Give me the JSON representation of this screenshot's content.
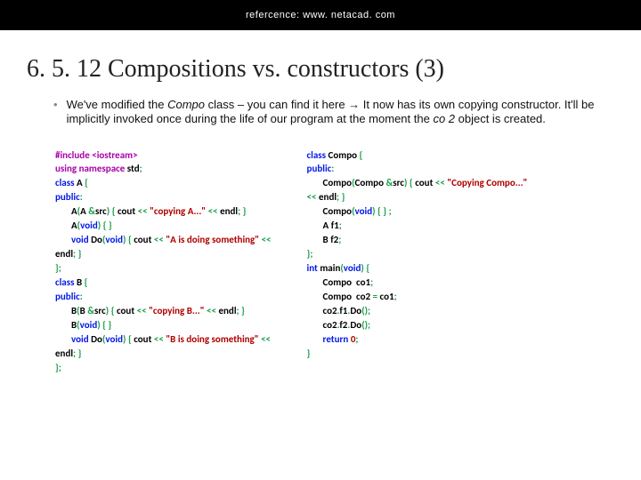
{
  "header": {
    "reference": "refercence: www. netacad. com"
  },
  "title": "6. 5. 12 Compositions vs. constructors (3)",
  "bullet": {
    "pre": "We've modified the ",
    "italic1": "Compo",
    "mid": " class – you can find it here → It now has its own copying constructor. It'll be implicitly invoked once during the life of our program at the moment the ",
    "italic2": "co 2",
    "post": " object is created."
  },
  "code": {
    "left": [
      [
        {
          "c": "pp",
          "t": "#include <iostream>"
        }
      ],
      [
        {
          "c": "pp",
          "t": "using namespace "
        },
        {
          "c": "id",
          "t": "std"
        },
        {
          "c": "pn2",
          "t": ";"
        }
      ],
      [
        {
          "c": "kw",
          "t": "class "
        },
        {
          "c": "id",
          "t": "A "
        },
        {
          "c": "pn2",
          "t": "{"
        }
      ],
      [
        {
          "c": "kw",
          "t": "public"
        },
        {
          "c": "pn2",
          "t": ":"
        }
      ],
      [
        {
          "c": "sp",
          "t": ""
        },
        {
          "c": "id",
          "t": "A"
        },
        {
          "c": "pn2",
          "t": "("
        },
        {
          "c": "id",
          "t": "A "
        },
        {
          "c": "pn2",
          "t": "&"
        },
        {
          "c": "id",
          "t": "src"
        },
        {
          "c": "pn2",
          "t": ") { "
        },
        {
          "c": "id",
          "t": "cout "
        },
        {
          "c": "pn2",
          "t": "<< "
        },
        {
          "c": "str",
          "t": "\"copying A...\""
        },
        {
          "c": "pn2",
          "t": " << "
        },
        {
          "c": "id",
          "t": "endl"
        },
        {
          "c": "pn2",
          "t": "; }"
        }
      ],
      [
        {
          "c": "sp",
          "t": ""
        },
        {
          "c": "id",
          "t": "A"
        },
        {
          "c": "pn2",
          "t": "("
        },
        {
          "c": "kw",
          "t": "void"
        },
        {
          "c": "pn2",
          "t": ") { }"
        }
      ],
      [
        {
          "c": "sp",
          "t": ""
        },
        {
          "c": "kw",
          "t": "void "
        },
        {
          "c": "id",
          "t": "Do"
        },
        {
          "c": "pn2",
          "t": "("
        },
        {
          "c": "kw",
          "t": "void"
        },
        {
          "c": "pn2",
          "t": ") { "
        },
        {
          "c": "id",
          "t": "cout "
        },
        {
          "c": "pn2",
          "t": "<< "
        },
        {
          "c": "str",
          "t": "\"A is doing something\""
        },
        {
          "c": "pn2",
          "t": " <<"
        }
      ],
      [
        {
          "c": "id",
          "t": "endl"
        },
        {
          "c": "pn2",
          "t": "; }"
        }
      ],
      [
        {
          "c": "pn2",
          "t": "};"
        }
      ],
      [
        {
          "c": "kw",
          "t": "class "
        },
        {
          "c": "id",
          "t": "B "
        },
        {
          "c": "pn2",
          "t": "{"
        }
      ],
      [
        {
          "c": "kw",
          "t": "public"
        },
        {
          "c": "pn2",
          "t": ":"
        }
      ],
      [
        {
          "c": "sp",
          "t": ""
        },
        {
          "c": "id",
          "t": "B"
        },
        {
          "c": "pn2",
          "t": "("
        },
        {
          "c": "id",
          "t": "B "
        },
        {
          "c": "pn2",
          "t": "&"
        },
        {
          "c": "id",
          "t": "src"
        },
        {
          "c": "pn2",
          "t": ") { "
        },
        {
          "c": "id",
          "t": "cout "
        },
        {
          "c": "pn2",
          "t": "<< "
        },
        {
          "c": "str",
          "t": "\"copying B...\""
        },
        {
          "c": "pn2",
          "t": " << "
        },
        {
          "c": "id",
          "t": "endl"
        },
        {
          "c": "pn2",
          "t": "; }"
        }
      ],
      [
        {
          "c": "sp",
          "t": ""
        },
        {
          "c": "id",
          "t": "B"
        },
        {
          "c": "pn2",
          "t": "("
        },
        {
          "c": "kw",
          "t": "void"
        },
        {
          "c": "pn2",
          "t": ") { }"
        }
      ],
      [
        {
          "c": "sp",
          "t": ""
        },
        {
          "c": "kw",
          "t": "void "
        },
        {
          "c": "id",
          "t": "Do"
        },
        {
          "c": "pn2",
          "t": "("
        },
        {
          "c": "kw",
          "t": "void"
        },
        {
          "c": "pn2",
          "t": ") { "
        },
        {
          "c": "id",
          "t": "cout "
        },
        {
          "c": "pn2",
          "t": "<< "
        },
        {
          "c": "str",
          "t": "\"B is doing something\""
        },
        {
          "c": "pn2",
          "t": " <<"
        }
      ],
      [
        {
          "c": "id",
          "t": "endl"
        },
        {
          "c": "pn2",
          "t": "; }"
        }
      ],
      [
        {
          "c": "pn2",
          "t": "};"
        }
      ]
    ],
    "right": [
      [
        {
          "c": "kw",
          "t": "class "
        },
        {
          "c": "id",
          "t": "Compo "
        },
        {
          "c": "pn2",
          "t": "{"
        }
      ],
      [
        {
          "c": "kw",
          "t": "public"
        },
        {
          "c": "pn2",
          "t": ":"
        }
      ],
      [
        {
          "c": "sp",
          "t": ""
        },
        {
          "c": "id",
          "t": "Compo"
        },
        {
          "c": "pn2",
          "t": "("
        },
        {
          "c": "id",
          "t": "Compo "
        },
        {
          "c": "pn2",
          "t": "&"
        },
        {
          "c": "id",
          "t": "src"
        },
        {
          "c": "pn2",
          "t": ") { "
        },
        {
          "c": "id",
          "t": "cout "
        },
        {
          "c": "pn2",
          "t": "<< "
        },
        {
          "c": "str",
          "t": "\"Copying Compo...\""
        }
      ],
      [
        {
          "c": "pn2",
          "t": "<< "
        },
        {
          "c": "id",
          "t": "endl"
        },
        {
          "c": "pn2",
          "t": "; }"
        }
      ],
      [
        {
          "c": "sp",
          "t": ""
        },
        {
          "c": "id",
          "t": "Compo"
        },
        {
          "c": "pn2",
          "t": "("
        },
        {
          "c": "kw",
          "t": "void"
        },
        {
          "c": "pn2",
          "t": ") { } ;"
        }
      ],
      [
        {
          "c": "sp",
          "t": ""
        },
        {
          "c": "id",
          "t": "A f1"
        },
        {
          "c": "pn2",
          "t": ";"
        }
      ],
      [
        {
          "c": "sp",
          "t": ""
        },
        {
          "c": "id",
          "t": "B f2"
        },
        {
          "c": "pn2",
          "t": ";"
        }
      ],
      [
        {
          "c": "pn2",
          "t": "};"
        }
      ],
      [
        {
          "c": "kw",
          "t": "int "
        },
        {
          "c": "id",
          "t": "main"
        },
        {
          "c": "pn2",
          "t": "("
        },
        {
          "c": "kw",
          "t": "void"
        },
        {
          "c": "pn2",
          "t": ") {"
        }
      ],
      [
        {
          "c": "sp",
          "t": ""
        },
        {
          "c": "id",
          "t": "Compo  co1"
        },
        {
          "c": "pn2",
          "t": ";"
        }
      ],
      [
        {
          "c": "sp",
          "t": ""
        },
        {
          "c": "id",
          "t": "Compo  co2 "
        },
        {
          "c": "pn2",
          "t": "= "
        },
        {
          "c": "id",
          "t": "co1"
        },
        {
          "c": "pn2",
          "t": ";"
        }
      ],
      [
        {
          "c": "sp",
          "t": ""
        },
        {
          "c": "id",
          "t": "co2"
        },
        {
          "c": "pn2",
          "t": "."
        },
        {
          "c": "id",
          "t": "f1"
        },
        {
          "c": "pn2",
          "t": "."
        },
        {
          "c": "id",
          "t": "Do"
        },
        {
          "c": "pn2",
          "t": "();"
        }
      ],
      [
        {
          "c": "sp",
          "t": ""
        },
        {
          "c": "id",
          "t": "co2"
        },
        {
          "c": "pn2",
          "t": "."
        },
        {
          "c": "id",
          "t": "f2"
        },
        {
          "c": "pn2",
          "t": "."
        },
        {
          "c": "id",
          "t": "Do"
        },
        {
          "c": "pn2",
          "t": "();"
        }
      ],
      [
        {
          "c": "sp",
          "t": ""
        },
        {
          "c": "kw",
          "t": "return "
        },
        {
          "c": "num",
          "t": "0"
        },
        {
          "c": "pn2",
          "t": ";"
        }
      ],
      [
        {
          "c": "pn2",
          "t": "}"
        }
      ]
    ]
  }
}
